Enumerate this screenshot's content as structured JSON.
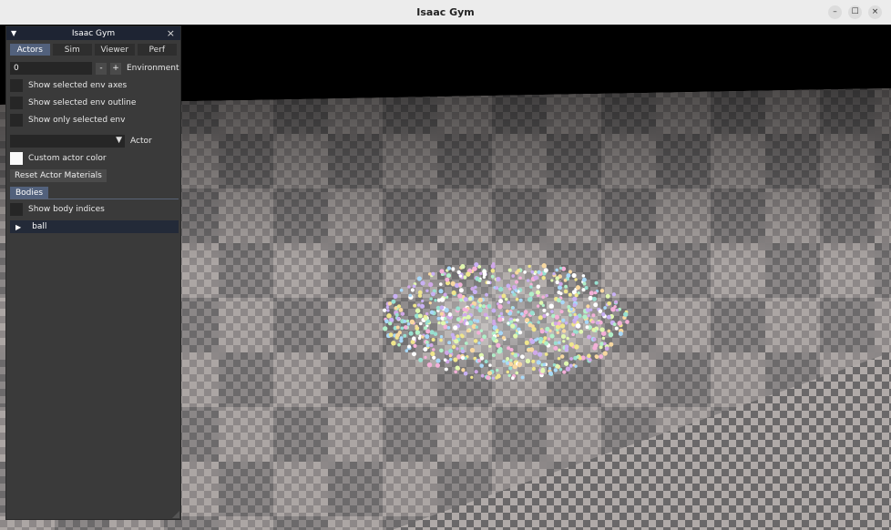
{
  "window": {
    "title": "Isaac Gym",
    "minimize_glyph": "–",
    "maximize_glyph": "☐",
    "close_glyph": "×"
  },
  "panel": {
    "title": "Isaac Gym",
    "collapse_glyph": "▼",
    "close_glyph": "×",
    "tabs": [
      {
        "label": "Actors",
        "active": true
      },
      {
        "label": "Sim",
        "active": false
      },
      {
        "label": "Viewer",
        "active": false
      },
      {
        "label": "Perf",
        "active": false
      }
    ],
    "environment": {
      "value": "0",
      "minus": "-",
      "plus": "+",
      "label": "Environment"
    },
    "checks": [
      {
        "label": "Show selected env axes",
        "checked": false
      },
      {
        "label": "Show selected env outline",
        "checked": false
      },
      {
        "label": "Show only selected env",
        "checked": false
      }
    ],
    "actor": {
      "value": "",
      "drop_glyph": "▼",
      "label": "Actor"
    },
    "custom_color": {
      "label": "Custom actor color"
    },
    "reset_button": "Reset Actor Materials",
    "bodies_tab": "Bodies",
    "show_body_indices": "Show body indices",
    "tree": [
      {
        "label": "ball",
        "expand_glyph": "▶"
      }
    ]
  },
  "colors": {
    "panel_bg": "#3a3a3a",
    "accent_tab": "#52617c",
    "title_bar": "#1e2433",
    "tile_light": "#a8a2a0",
    "tile_dark": "#6f6d6d"
  }
}
